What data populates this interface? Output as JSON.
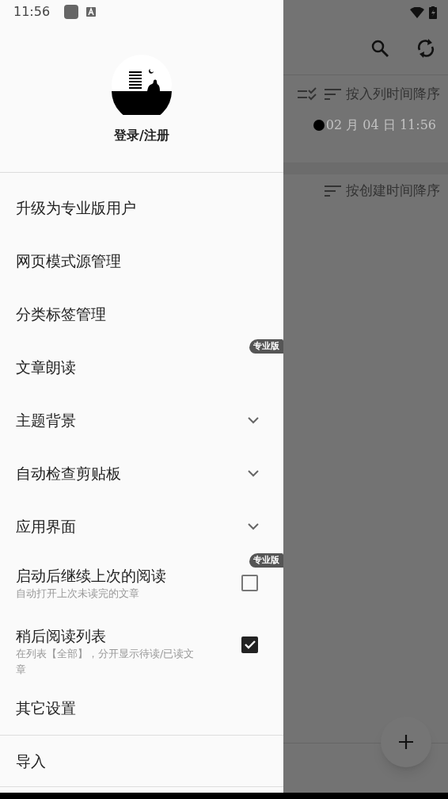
{
  "status_bar": {
    "time": "11:56"
  },
  "background": {
    "sections": [
      {
        "sort_label": "按入列时间降序",
        "show_check_icon": true,
        "entries": [
          "02 月 04 日 11:56"
        ]
      },
      {
        "sort_label": "按创建时间降序",
        "show_check_icon": false
      }
    ]
  },
  "drawer": {
    "account": {
      "label": "登录/注册"
    },
    "items": [
      {
        "kind": "link",
        "label": "升级为专业版用户"
      },
      {
        "kind": "link",
        "label": "网页模式源管理"
      },
      {
        "kind": "link",
        "label": "分类标签管理"
      },
      {
        "kind": "link",
        "label": "文章朗读",
        "badge": "专业版"
      },
      {
        "kind": "expandable",
        "label": "主题背景",
        "expanded": false
      },
      {
        "kind": "expandable",
        "label": "自动检查剪贴板",
        "expanded": false
      },
      {
        "kind": "expandable",
        "label": "应用界面",
        "expanded": false
      },
      {
        "kind": "checkbox",
        "label": "启动后继续上次的阅读",
        "description": "自动打开上次未读完的文章",
        "checked": false,
        "badge": "专业版"
      },
      {
        "kind": "checkbox",
        "label": "稍后阅读列表",
        "description": "在列表【全部】，分开显示待读/已读文章",
        "checked": true
      },
      {
        "kind": "link",
        "label": "其它设置"
      }
    ],
    "footer_items": [
      {
        "label": "导入"
      }
    ]
  }
}
